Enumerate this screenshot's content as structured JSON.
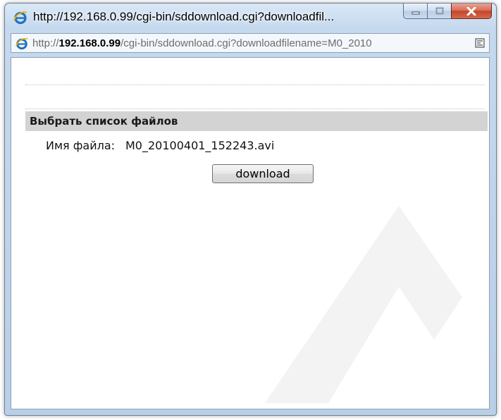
{
  "window": {
    "title": "http://192.168.0.99/cgi-bin/sddownload.cgi?downloadfil...",
    "address": {
      "prefix": "http://",
      "host": "192.168.0.99",
      "rest": "/cgi-bin/sddownload.cgi?downloadfilename=M0_2010"
    }
  },
  "page": {
    "section_title": "Выбрать список файлов",
    "file_label": "Имя файла:",
    "file_value": "M0_20100401_152243.avi",
    "download_label": "download"
  },
  "icons": {
    "browser": "ie-icon",
    "compat": "compat-view-icon",
    "minimize": "minimize-icon",
    "maximize": "maximize-icon",
    "close": "close-icon"
  },
  "colors": {
    "section_header_bg": "#d3d3d3",
    "close_button": "#c7452b",
    "ie_blue": "#1f6fc5"
  }
}
